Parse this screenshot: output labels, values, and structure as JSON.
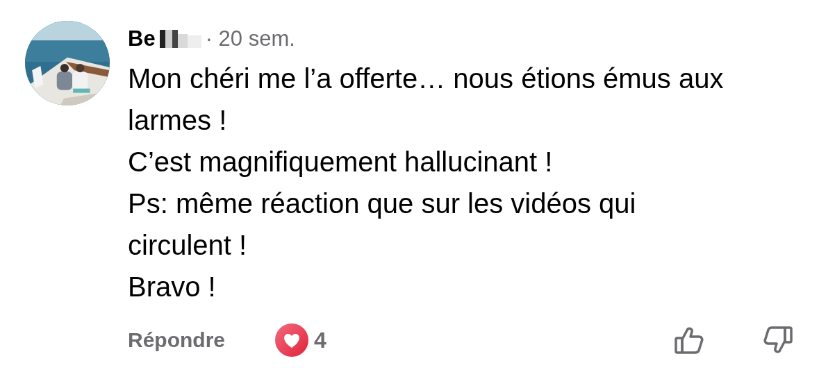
{
  "comment": {
    "author": "Be",
    "time": "· 20 sem.",
    "paragraphs": [
      "Mon chéri me l’a offerte… nous étions émus aux larmes !",
      "C’est magnifiquement hallucinant !",
      "Ps: même réaction que sur les vidéos qui circulent !",
      "Bravo !"
    ],
    "reply": "Répondre",
    "reaction_count": "4",
    "liked": false,
    "disliked": false
  }
}
